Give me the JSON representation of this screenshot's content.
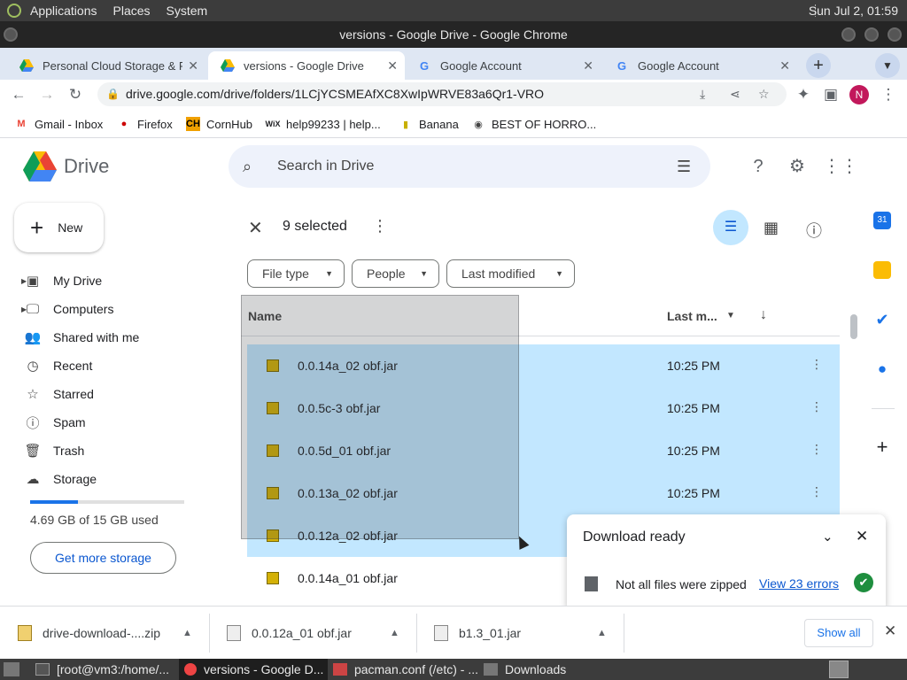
{
  "os_panel": {
    "menus": [
      "Applications",
      "Places",
      "System"
    ],
    "clock": "Sun Jul  2, 01:59"
  },
  "window": {
    "title": "versions - Google Drive - Google Chrome"
  },
  "tabs": [
    {
      "label": "Personal Cloud Storage & F",
      "close": "✕"
    },
    {
      "label": "versions - Google Drive",
      "close": "✕"
    },
    {
      "label": "Google Account",
      "close": "✕"
    },
    {
      "label": "Google Account",
      "close": "✕"
    }
  ],
  "browser": {
    "url": "drive.google.com/drive/folders/1LCjYCSMEAfXC8XwIpWRVE83a6Qr1-VRO",
    "profile_initial": "N"
  },
  "bookmarks": [
    "Gmail - Inbox",
    "Firefox",
    "CornHub",
    "help99233 | help...",
    "Banana",
    "BEST OF HORRO..."
  ],
  "drive": {
    "product": "Drive",
    "search_placeholder": "Search in Drive",
    "avatar": "N",
    "new_label": "New",
    "nav": [
      "My Drive",
      "Computers",
      "Shared with me",
      "Recent",
      "Starred",
      "Spam",
      "Trash",
      "Storage"
    ],
    "storage_text": "4.69 GB of 15 GB used",
    "storage_fraction": 0.31,
    "get_storage": "Get more storage",
    "selection": "9 selected",
    "filters": [
      "File type",
      "People",
      "Last modified"
    ],
    "columns": {
      "name": "Name",
      "modified": "Last m..."
    },
    "files": [
      {
        "name": "0.0.14a_02 obf.jar",
        "time": "10:25 PM",
        "selected": true
      },
      {
        "name": "0.0.5c-3 obf.jar",
        "time": "10:25 PM",
        "selected": true
      },
      {
        "name": "0.0.5d_01 obf.jar",
        "time": "10:25 PM",
        "selected": true
      },
      {
        "name": "0.0.13a_02 obf.jar",
        "time": "10:25 PM",
        "selected": true
      },
      {
        "name": "0.0.12a_02 obf.jar",
        "time": "",
        "selected": true
      },
      {
        "name": "0.0.14a_01 obf.jar",
        "time": "",
        "selected": false
      }
    ],
    "toast": {
      "title": "Download ready",
      "message": "Not all files were zipped",
      "link": "View 23 errors"
    }
  },
  "downloads": {
    "items": [
      "drive-download-....zip",
      "0.0.12a_01 obf.jar",
      "b1.3_01.jar"
    ],
    "show_all": "Show all"
  },
  "taskbar": [
    "[root@vm3:/home/...",
    "versions - Google D...",
    "pacman.conf (/etc) - ...",
    "Downloads"
  ],
  "colors": {
    "accent": "#1a73e8",
    "selection": "#c2e7ff",
    "avatar": "#c2185b"
  }
}
